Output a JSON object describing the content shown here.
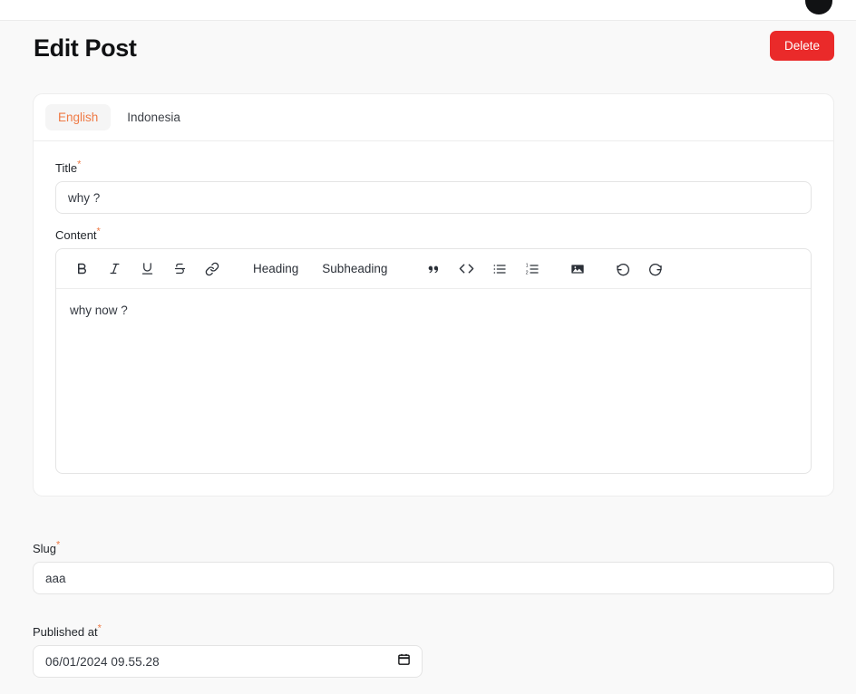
{
  "topbar": {
    "avatar_label": "user-avatar"
  },
  "header": {
    "title": "Edit Post",
    "delete_label": "Delete"
  },
  "tabs": [
    {
      "label": "English",
      "active": true
    },
    {
      "label": "Indonesia",
      "active": false
    }
  ],
  "fields": {
    "title": {
      "label": "Title",
      "required_mark": "*",
      "value": "why ?",
      "placeholder": ""
    },
    "content": {
      "label": "Content",
      "required_mark": "*",
      "value": "why now ?"
    },
    "slug": {
      "label": "Slug",
      "required_mark": "*",
      "value": "aaa",
      "placeholder": ""
    },
    "published_at": {
      "label": "Published at",
      "required_mark": "*",
      "value": "06/01/2024 09.55.28"
    }
  },
  "toolbar": {
    "bold": "B",
    "italic": "I",
    "underline": "U",
    "strikethrough": "S",
    "link": "link-icon",
    "heading": "Heading",
    "subheading": "Subheading",
    "quote": "quote-icon",
    "code": "code-icon",
    "bullet_list": "bullet-list-icon",
    "numbered_list": "numbered-list-icon",
    "image": "image-icon",
    "undo": "undo-icon",
    "redo": "redo-icon"
  },
  "colors": {
    "accent": "#ef7a45",
    "danger": "#ea2a2a",
    "page_bg": "#f9f9f9",
    "card_bg": "#ffffff",
    "border": "#ededed"
  }
}
